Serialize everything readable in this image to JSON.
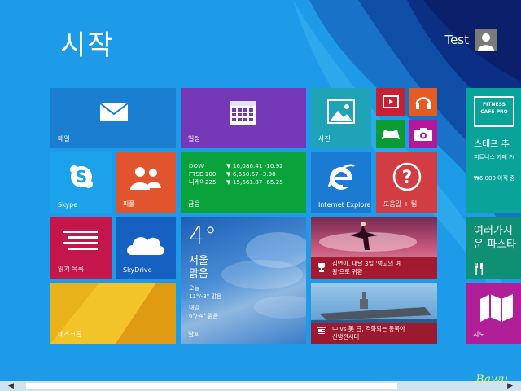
{
  "start_title": "시작",
  "user": {
    "name": "Test"
  },
  "tiles": {
    "mail": "메일",
    "calendar": "일정",
    "photos": "사진",
    "skype": "Skype",
    "people": "피플",
    "finance": {
      "label": "금융",
      "rows": [
        {
          "name": "DOW",
          "dir": "▼",
          "value": "16,086.41 -10.92"
        },
        {
          "name": "FTSE 100",
          "dir": "▼",
          "value": "6,650.57 -3.90"
        },
        {
          "name": "니케이225",
          "dir": "▼",
          "value": "15,661.87 -65.25"
        }
      ]
    },
    "ie": "Internet Explorer",
    "help": "도움말 + 팁",
    "reading": "읽기 목록",
    "skydrive": "SkyDrive",
    "weather": {
      "label": "날씨",
      "temp": "4°",
      "city": "서울",
      "condition": "맑음",
      "today_label": "오늘",
      "today": "11°/-3° 맑음",
      "tomorrow_label": "내일",
      "tomorrow": "6°/-4° 맑음"
    },
    "news1": {
      "line1": "김연아, 내달 3일 '탱고의 여",
      "line2": "왕'으로 귀환"
    },
    "news2": {
      "line1": "中 vs 美 日, 격화되는 동북아",
      "line2": "신냉전시대"
    },
    "desktop": "데스크톱",
    "fitness": {
      "logo_line1": "FITNESS",
      "logo_line2": "CAFE",
      "logo_line3": "PRO",
      "title": "스태프 추",
      "subtitle": "피트니스 카페 Pr",
      "price": "₩6,000 아직 중"
    },
    "food": {
      "line1": "여러가지",
      "line2": "운 파스타"
    },
    "maps": "지도"
  },
  "watermark": "Bawu",
  "colors": {
    "background": "#1e9be8",
    "mail": "#1a7fd0",
    "calendar": "#7438b9",
    "photos": "#1ea3b7",
    "skype": "#1ba2ea",
    "people": "#e1542d",
    "finance": "#0aa33b",
    "ie": "#1b7bd3",
    "help": "#d13d43",
    "reading": "#c4164a",
    "skydrive": "#1660c2",
    "desktop": "#e8b31a",
    "maps": "#b11f98"
  }
}
